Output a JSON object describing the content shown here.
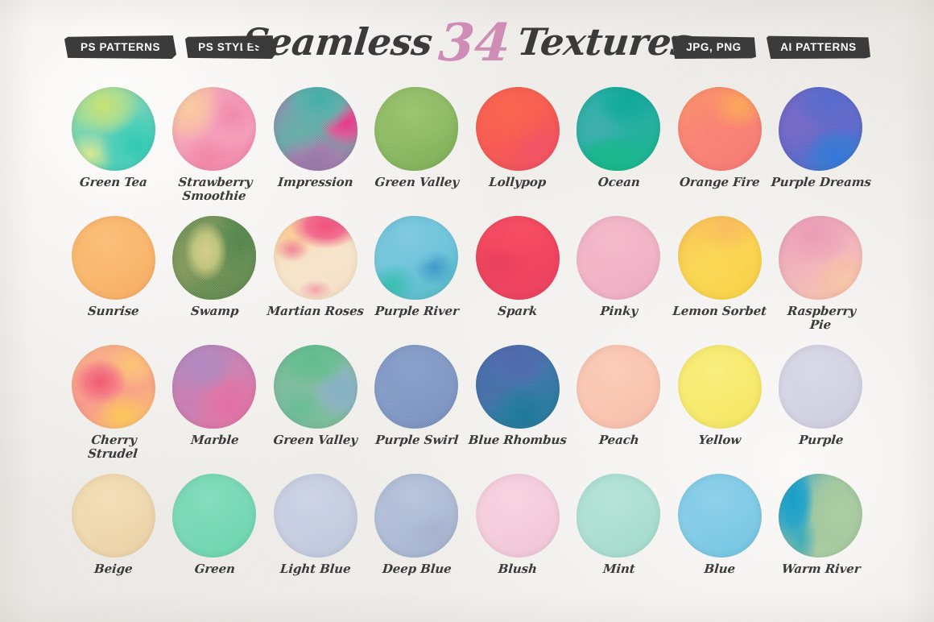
{
  "header": {
    "badges_left": [
      {
        "name": "ps-patterns",
        "label": "PS PATTERNS"
      },
      {
        "name": "ps-styles",
        "label": "PS STYLES"
      }
    ],
    "badges_right": [
      {
        "name": "jpg-png",
        "label": "JPG, PNG"
      },
      {
        "name": "ai-patterns",
        "label": "AI PATTERNS"
      }
    ],
    "title_part1": "Seamless",
    "title_number": "34",
    "title_part2": "Textures",
    "badge_bg": "#3b3b3b",
    "badge_text_color": "#ffffff",
    "title_color": "#3a3a3a",
    "number_color": "#cf8cb5"
  },
  "page": {
    "background_color": "#f2f0ed",
    "texture": "watercolor-paper"
  },
  "swatches": [
    {
      "label": "Green Tea",
      "base": "#6fd0b4",
      "gradient": "radial-gradient(ellipse 70% 60% at 38% 22%, #c2e06a 0%, #a8dc86 30%, rgba(168,220,134,0) 62%), radial-gradient(ellipse 60% 55% at 78% 70%, #2ec4ab 0%, #46c9b2 40%, rgba(70,201,178,0) 75%), radial-gradient(ellipse 55% 45% at 22% 80%, #d8e88a 0%, rgba(216,232,138,0) 60%), linear-gradient(150deg, #9ad98f 0%, #5fcdb6 55%, #38c3ab 100%)"
    },
    {
      "label": "Strawberry\nSmoothie",
      "base": "#f08aa8",
      "gradient": "radial-gradient(ellipse 55% 60% at 20% 24%, #f9c79a 0%, #f7b9a0 35%, rgba(247,185,160,0) 70%), radial-gradient(ellipse 60% 55% at 72% 34%, #ef7fa4 0%, #f294b4 45%, rgba(242,148,180,0) 78%), radial-gradient(ellipse 50% 45% at 42% 86%, #ef7c9f 0%, rgba(239,124,159,0) 66%), linear-gradient(145deg, #f8bfa2 0%, #f49ab4 45%, #ee7ca2 100%)"
    },
    {
      "label": "Impression",
      "base": "#6aa6a5",
      "gradient": "radial-gradient(ellipse 55% 50% at 55% 14%, #3fa8a2 0%, #5aa8a4 45%, rgba(90,168,164,0) 78%), radial-gradient(ellipse 45% 40% at 86% 42%, #e3357e 0%, #d4588f 40%, rgba(212,88,143,0) 72%), radial-gradient(ellipse 50% 45% at 30% 52%, #63a8a0 0%, rgba(99,168,160,0) 70%), radial-gradient(ellipse 60% 45% at 48% 90%, #8a6f9e 0%, #9a74a4 40%, rgba(154,116,164,0) 80%), linear-gradient(135deg, #8f7fa8 0%, #5fa5a2 45%, #9d6f9c 100%)"
    },
    {
      "label": "Green Valley",
      "base": "#85b45f",
      "gradient": "radial-gradient(ellipse 70% 60% at 45% 30%, #95bf69 0%, #8ab861 45%, rgba(138,184,97,0) 80%), linear-gradient(150deg, #93bd6a 0%, #82b35d 55%, #76a854 100%)"
    },
    {
      "label": "Lollypop",
      "base": "#f4574c",
      "gradient": "radial-gradient(ellipse 65% 55% at 38% 26%, #fa5f49 0%, #f65a4c 45%, rgba(246,90,76,0) 80%), radial-gradient(ellipse 55% 50% at 75% 72%, #ef4e5e 0%, rgba(239,78,94,0) 70%), linear-gradient(150deg, #fb6147 0%, #f4544f 55%, #ed4a5c 100%)"
    },
    {
      "label": "Ocean",
      "base": "#23a79a",
      "gradient": "radial-gradient(ellipse 50% 42% at 62% 16%, #10a08f 0%, #1ba396 45%, rgba(27,163,150,0) 80%), radial-gradient(ellipse 60% 38% at 45% 88%, #19b07d 0%, #1cae86 45%, rgba(28,174,134,0) 82%), radial-gradient(ellipse 55% 50% at 25% 48%, #3fa8a8 0%, rgba(63,168,168,0) 72%), linear-gradient(150deg, #2aa89f 0%, #27a79a 50%, #17ad83 100%)"
    },
    {
      "label": "Orange Fire",
      "base": "#f8786a",
      "gradient": "radial-gradient(ellipse 45% 38% at 72% 22%, #fba155 0%, #fa8f5f 40%, rgba(250,143,95,0) 74%), radial-gradient(ellipse 55% 50% at 32% 60%, #f87a6d 0%, rgba(248,122,109,0) 72%), linear-gradient(150deg, #fa8a64 0%, #f87a6c 50%, #f4706e 100%)"
    },
    {
      "label": "Purple Dreams",
      "base": "#6464bf",
      "gradient": "radial-gradient(ellipse 55% 45% at 60% 16%, #4f63c9 0%, #5a63c2 45%, rgba(90,99,194,0) 80%), radial-gradient(ellipse 50% 45% at 70% 84%, #2f6fd4 0%, #3d6fca 45%, rgba(61,111,202,0) 80%), radial-gradient(ellipse 50% 50% at 22% 45%, #7063bd 0%, rgba(112,99,189,0) 72%), linear-gradient(150deg, #6a5fc4 0%, #6061c2 50%, #3a6ecd 100%)"
    },
    {
      "label": "Sunrise",
      "base": "#f9b268",
      "gradient": "radial-gradient(ellipse 70% 60% at 42% 30%, #fbbb73 0%, #f9b268 48%, rgba(249,178,104,0) 82%), linear-gradient(150deg, #fbbd76 0%, #f9b167 55%, #f5a55e 100%)"
    },
    {
      "label": "Swamp",
      "base": "#6f8c54",
      "gradient": "radial-gradient(ellipse 36% 50% at 40% 42%, #cfc985 0%, #b9bf74 40%, rgba(185,191,116,0) 72%), radial-gradient(ellipse 45% 55% at 80% 30%, #4f7c4a 0%, #5d8450 45%, rgba(93,132,80,0) 80%), radial-gradient(ellipse 40% 50% at 14% 60%, #7c9159 0%, rgba(124,145,89,0) 72%), linear-gradient(150deg, #72905a 0%, #6c8a54 50%, #5a7f4b 100%)"
    },
    {
      "label": "Martian Roses",
      "base": "#f3d9ba",
      "gradient": "radial-gradient(ellipse 60% 38% at 62% 12%, #ef4b73 0%, #ef6685 38%, rgba(239,102,133,0) 72%), radial-gradient(ellipse 30% 22% at 22% 40%, #ee7a8e 0%, rgba(238,122,142,0) 70%), radial-gradient(ellipse 28% 16% at 50% 88%, #f09aa4 0%, rgba(240,154,164,0) 72%), radial-gradient(ellipse 50% 45% at 20% 22%, #fbc98e 0%, rgba(251,201,142,0) 66%), linear-gradient(160deg, #f7d2a5 0%, #f6e3c8 55%, #f3dcc2 100%)"
    },
    {
      "label": "Purple River",
      "base": "#6ec2d9",
      "gradient": "radial-gradient(ellipse 55% 50% at 42% 24%, #79c6dc 0%, #6dc0d8 48%, rgba(109,192,216,0) 80%), radial-gradient(ellipse 35% 30% at 72% 62%, #3c8fc4 0%, rgba(60,143,196,0) 72%), radial-gradient(ellipse 40% 35% at 22% 82%, #34b8a8 0%, rgba(52,184,168,0) 74%), linear-gradient(150deg, #7cc8dc 0%, #68bfd7 55%, #4eb4bd 100%)"
    },
    {
      "label": "Spark",
      "base": "#ef4257",
      "gradient": "radial-gradient(ellipse 60% 45% at 52% 14%, #f4485a 0%, #f0455a 45%, rgba(240,69,90,0) 80%), radial-gradient(ellipse 50% 45% at 28% 58%, #e23b56 0%, rgba(226,59,86,0) 72%), linear-gradient(150deg, #f4495b 0%, #ee4258 50%, #e63d5a 100%)"
    },
    {
      "label": "Pinky",
      "base": "#f1afc5",
      "gradient": "radial-gradient(ellipse 65% 55% at 44% 30%, #f3b5c9 0%, #f0aec4 48%, rgba(240,174,196,0) 82%), linear-gradient(150deg, #f4b8cb 0%, #f0adc3 55%, #eca5bd 100%)"
    },
    {
      "label": "Lemon Sorbet",
      "base": "#f9cf4c",
      "gradient": "radial-gradient(ellipse 50% 40% at 58% 12%, #fbb55a 0%, #fac155 42%, rgba(250,193,85,0) 76%), radial-gradient(ellipse 60% 55% at 38% 62%, #f9d452 0%, rgba(249,212,82,0) 74%), linear-gradient(155deg, #fabd56 0%, #f9d04e 50%, #f6cf43 100%)"
    },
    {
      "label": "Raspberry\nPie",
      "base": "#eea9b8",
      "gradient": "radial-gradient(ellipse 60% 50% at 42% 20%, #e993b0 0%, #ec9fb4 45%, rgba(236,159,180,0) 80%), radial-gradient(ellipse 50% 45% at 80% 78%, #f6c3a4 0%, #f4b8a4 45%, rgba(244,184,164,0) 80%), linear-gradient(150deg, #e994b1 0%, #efaeb6 50%, #f6c5a6 100%)"
    },
    {
      "label": "Cherry\nStrudel",
      "base": "#f89a86",
      "gradient": "radial-gradient(ellipse 45% 38% at 34% 44%, #ee5668 0%, #f1707b 38%, rgba(241,112,123,0) 72%), radial-gradient(ellipse 50% 40% at 72% 24%, #fbbf6e 0%, #fbb178 40%, rgba(251,177,120,0) 76%), radial-gradient(ellipse 45% 40% at 60% 84%, #fcc254 0%, rgba(252,194,84,0) 72%), linear-gradient(150deg, #f9b27e 0%, #f79083 50%, #fbc266 100%)"
    },
    {
      "label": "Marble",
      "base": "#cd7aa5",
      "gradient": "radial-gradient(ellipse 50% 45% at 34% 22%, #a97fbd 0%, #b07db4 45%, rgba(176,125,180,0) 80%), radial-gradient(ellipse 55% 50% at 70% 72%, #e0679f 0%, #d86f9f 45%, rgba(216,111,159,0) 80%), radial-gradient(ellipse 40% 45% at 18% 70%, #c175ad 0%, rgba(193,117,173,0) 72%), linear-gradient(150deg, #ad7fbb 0%, #c878aa 50%, #e0689e 100%)"
    },
    {
      "label": "Green Valley",
      "base": "#71b58f",
      "gradient": "radial-gradient(ellipse 55% 45% at 46% 16%, #5bb783 0%, #64b88a 45%, rgba(100,184,138,0) 80%), radial-gradient(ellipse 45% 45% at 80% 54%, #7ba9c0 0%, #83aeb9 45%, rgba(131,174,185,0) 78%), radial-gradient(ellipse 50% 45% at 30% 76%, #5fb78c 0%, rgba(95,183,140,0) 72%), linear-gradient(150deg, #63b786 0%, #7fb69c 50%, #6fb78e 100%)"
    },
    {
      "label": "Purple Swirl",
      "base": "#7b94c2",
      "gradient": "radial-gradient(ellipse 60% 55% at 44% 28%, #8099c6 0%, #7b93c1 48%, rgba(123,147,193,0) 82%), linear-gradient(150deg, #8299c8 0%, #7a92c0 55%, #7189b8 100%)"
    },
    {
      "label": "Blue Rhombus",
      "base": "#3f6fa4",
      "gradient": "radial-gradient(ellipse 55% 45% at 48% 16%, #4a61a4 0%, #4a66a6 45%, rgba(74,102,166,0) 80%), radial-gradient(ellipse 55% 45% at 58% 84%, #1b6f8f 0%, #2a7196 45%, rgba(42,113,150,0) 82%), radial-gradient(ellipse 45% 45% at 20% 52%, #45689f 0%, rgba(69,104,159,0) 72%), linear-gradient(150deg, #4a62a3 0%, #3e6fa2 50%, #1d7191 100%)"
    },
    {
      "label": "Peach",
      "base": "#f9c3ae",
      "gradient": "radial-gradient(ellipse 65% 55% at 44% 30%, #fbc9b4 0%, #f9c2ad 48%, rgba(249,194,173,0) 82%), linear-gradient(150deg, #fbccb6 0%, #f9c1ac 55%, #f6b8a4 100%)"
    },
    {
      "label": "Yellow",
      "base": "#f7ea6c",
      "gradient": "radial-gradient(ellipse 65% 55% at 44% 30%, #f9ee78 0%, #f7ea6c 48%, rgba(247,234,108,0) 82%), linear-gradient(150deg, #f9ef7b 0%, #f7e968 55%, #f4e45e 100%)"
    },
    {
      "label": "Purple",
      "base": "#d2d1e2",
      "gradient": "radial-gradient(ellipse 65% 55% at 44% 30%, #d8d6e6 0%, #d2d1e2 48%, rgba(210,209,226,0) 82%), linear-gradient(150deg, #dad8e8 0%, #d1d0e1 55%, #c9c8dc 100%)"
    },
    {
      "label": "Beige",
      "base": "#efd7ab",
      "gradient": "radial-gradient(ellipse 65% 55% at 44% 30%, #f2dcb4 0%, #efd7ab 48%, rgba(239,215,171,0) 82%), linear-gradient(150deg, #f3ddb7 0%, #eed5a9 55%, #e9cd9e 100%)"
    },
    {
      "label": "Green",
      "base": "#72d6b2",
      "gradient": "radial-gradient(ellipse 65% 55% at 44% 30%, #7ddab9 0%, #72d6b2 48%, rgba(114,214,178,0) 82%), linear-gradient(150deg, #80dbbc 0%, #70d5b1 55%, #64d0a8 100%)"
    },
    {
      "label": "Light Blue",
      "base": "#c3cbdf",
      "gradient": "radial-gradient(ellipse 65% 55% at 44% 30%, #cad1e3 0%, #c3cbdf 48%, rgba(195,203,223,0) 82%), linear-gradient(150deg, #ccd3e5 0%, #c2cade 55%, #b9c2d9 100%)"
    },
    {
      "label": "Deep Blue",
      "base": "#abb9d4",
      "gradient": "radial-gradient(ellipse 60% 50% at 46% 26%, #b3c0d8 0%, #abb9d4 48%, rgba(171,185,212,0) 82%), radial-gradient(ellipse 45% 40% at 72% 70%, #9facc9 0%, rgba(159,172,201,0) 74%), linear-gradient(150deg, #b5c1da 0%, #a9b7d3 55%, #9dacc9 100%)"
    },
    {
      "label": "Blush",
      "base": "#f4cada",
      "gradient": "radial-gradient(ellipse 65% 55% at 44% 30%, #f7d1df 0%, #f4cada 48%, rgba(244,202,218,0) 82%), linear-gradient(150deg, #f8d4e1 0%, #f3c8d9 55%, #eec0d3 100%)"
    },
    {
      "label": "Mint",
      "base": "#a9ded0",
      "gradient": "radial-gradient(ellipse 65% 55% at 44% 30%, #b2e2d5 0%, #a9ded0 48%, rgba(169,222,208,0) 82%), linear-gradient(150deg, #b6e4d8 0%, #a7ddcf 55%, #9cd7c7 100%)"
    },
    {
      "label": "Blue",
      "base": "#7bc8e4",
      "gradient": "radial-gradient(ellipse 65% 55% at 44% 30%, #86cde7 0%, #7bc8e4 48%, rgba(123,200,228,0) 82%), linear-gradient(150deg, #8bd0e9 0%, #79c7e3 55%, #6cc0de 100%)"
    },
    {
      "label": "Warm River",
      "base": "#9ec79b",
      "gradient": "radial-gradient(ellipse 36% 72% at 18% 32%, #1796c4 0%, #2b9dc2 38%, rgba(43,157,194,0) 68%), radial-gradient(ellipse 30% 50% at 26% 78%, #3aa6b2 0%, rgba(58,166,178,0) 70%), radial-gradient(ellipse 60% 70% at 76% 50%, #a6c89c 0%, #9ec598 45%, rgba(158,197,152,0) 84%), linear-gradient(110deg, #2b9cc1 0%, #6ab4ae 28%, #a4c79a 58%, #a8c99d 100%)"
    }
  ]
}
